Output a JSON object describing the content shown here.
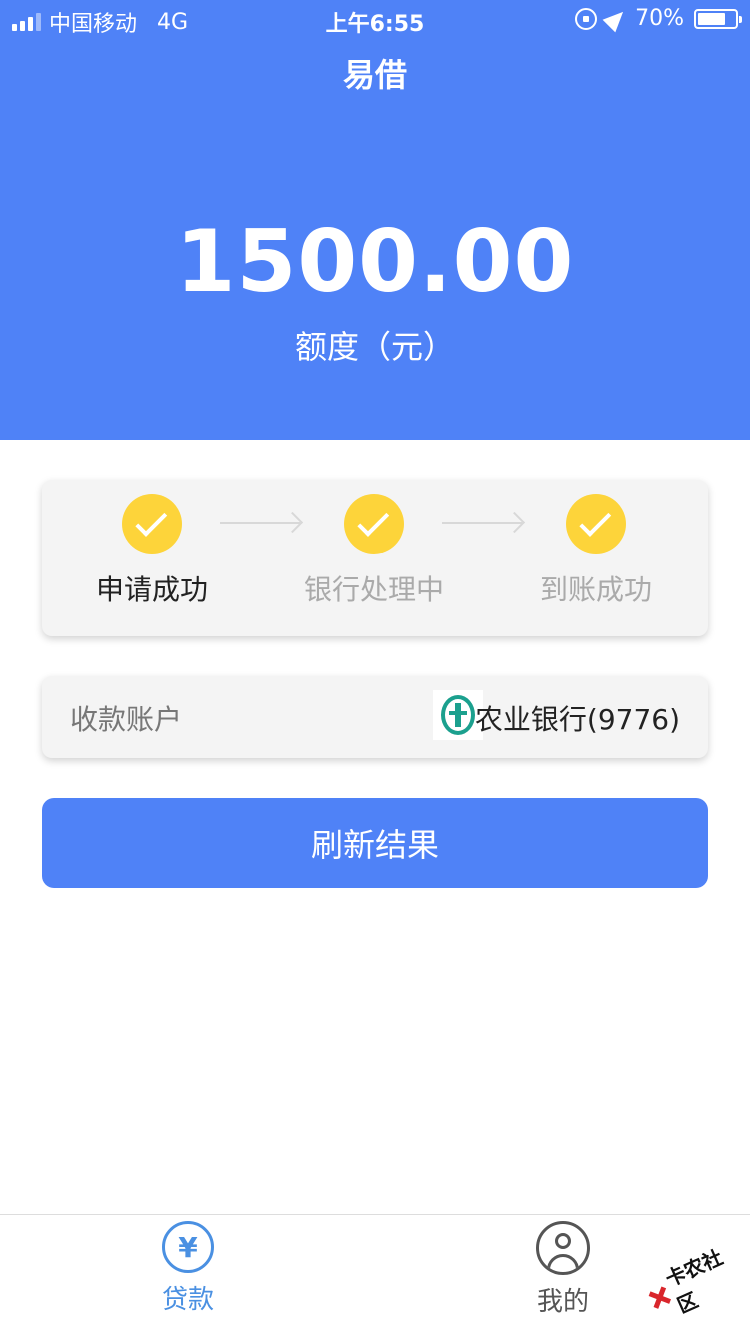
{
  "status_bar": {
    "carrier": "中国移动",
    "network": "4G",
    "time": "上午6:55",
    "battery": "70%"
  },
  "header": {
    "title": "易借",
    "amount": "1500.00",
    "amount_label": "额度（元）"
  },
  "progress": {
    "steps": [
      {
        "label": "申请成功",
        "status": "active"
      },
      {
        "label": "银行处理中",
        "status": "done"
      },
      {
        "label": "到账成功",
        "status": "done"
      }
    ]
  },
  "account": {
    "label": "收款账户",
    "bank": "农业银行(9776)"
  },
  "actions": {
    "refresh_label": "刷新结果"
  },
  "tab_bar": {
    "tabs": [
      {
        "label": "贷款",
        "icon": "yuan-icon",
        "active": true
      },
      {
        "label": "我的",
        "icon": "user-icon",
        "active": false
      }
    ]
  },
  "watermark": {
    "text": "卡农社区"
  },
  "colors": {
    "brand_blue": "#4f82f7",
    "step_yellow": "#fdd43a",
    "tab_active": "#4a90e2"
  }
}
